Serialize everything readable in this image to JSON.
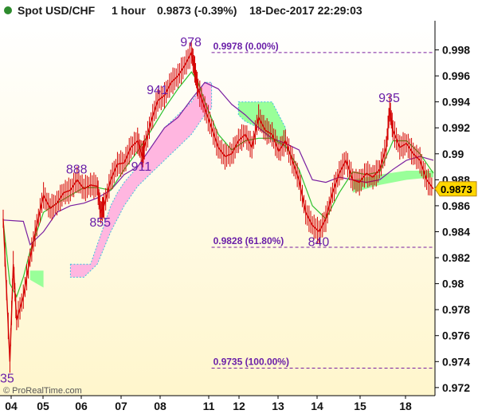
{
  "header": {
    "instrument": "Spot USD/CHF",
    "timeframe": "1 hour",
    "last_price_change": "0.9873 (-0.39%)",
    "datetime": "18-Dec-2017 22:29:03",
    "status_color": "#2e8b2e"
  },
  "credit": "© ProRealTime.com",
  "chart_data": {
    "type": "line",
    "title": "Spot USD/CHF",
    "xlabel": "",
    "ylabel": "",
    "x_ticks": [
      "04",
      "05",
      "06",
      "07",
      "08",
      "11",
      "12",
      "13",
      "14",
      "15",
      "18"
    ],
    "y_ticks": [
      "0.972",
      "0.974",
      "0.976",
      "0.978",
      "0.98",
      "0.982",
      "0.984",
      "0.986",
      "0.988",
      "0.99",
      "0.992",
      "0.994",
      "0.996",
      "0.998"
    ],
    "ylim": [
      0.9715,
      1.0
    ],
    "grid": false,
    "last_price": "0.9873",
    "last_price_value": 0.9873,
    "colors": {
      "price": "#d40000",
      "tenkan": "#2fc12f",
      "kijun": "#7a1fa0",
      "cloud_bull": "#99ff99",
      "cloud_bear": "#ffb6e0",
      "span_a_line": "#40c0e0",
      "fib_line": "#7a1fa0",
      "background_top": "#ffffff",
      "background_bottom": "#fff6cc"
    },
    "price_path": [
      [
        0.0,
        0.985
      ],
      [
        1.0,
        0.974
      ],
      [
        1.5,
        0.9815
      ],
      [
        2.0,
        0.9772
      ],
      [
        3.0,
        0.979
      ],
      [
        4.0,
        0.982
      ],
      [
        5.0,
        0.9845
      ],
      [
        6.0,
        0.9868
      ],
      [
        7.0,
        0.9858
      ],
      [
        8.0,
        0.9862
      ],
      [
        9.0,
        0.987
      ],
      [
        10.0,
        0.9872
      ],
      [
        11.0,
        0.988
      ],
      [
        12.0,
        0.9873
      ],
      [
        13.0,
        0.9876
      ],
      [
        14.0,
        0.9875
      ],
      [
        14.5,
        0.9855
      ],
      [
        15.0,
        0.986
      ],
      [
        16.0,
        0.988
      ],
      [
        17.0,
        0.9892
      ],
      [
        18.0,
        0.9893
      ],
      [
        19.0,
        0.9905
      ],
      [
        20.0,
        0.991
      ],
      [
        20.7,
        0.9898
      ],
      [
        21.0,
        0.9905
      ],
      [
        22.0,
        0.9925
      ],
      [
        23.0,
        0.9941
      ],
      [
        24.0,
        0.9945
      ],
      [
        25.0,
        0.9955
      ],
      [
        26.0,
        0.996
      ],
      [
        27.0,
        0.9968
      ],
      [
        28.0,
        0.9978
      ],
      [
        28.5,
        0.9965
      ],
      [
        29.0,
        0.995
      ],
      [
        30.0,
        0.9935
      ],
      [
        31.0,
        0.992
      ],
      [
        32.0,
        0.9905
      ],
      [
        33.0,
        0.9898
      ],
      [
        34.0,
        0.99
      ],
      [
        35.0,
        0.991
      ],
      [
        36.0,
        0.9915
      ],
      [
        37.0,
        0.9905
      ],
      [
        38.0,
        0.9928
      ],
      [
        39.0,
        0.9918
      ],
      [
        40.0,
        0.9915
      ],
      [
        41.0,
        0.9902
      ],
      [
        42.0,
        0.991
      ],
      [
        43.0,
        0.9895
      ],
      [
        44.0,
        0.988
      ],
      [
        45.0,
        0.9855
      ],
      [
        46.0,
        0.9845
      ],
      [
        47.0,
        0.984
      ],
      [
        48.0,
        0.985
      ],
      [
        49.0,
        0.987
      ],
      [
        50.0,
        0.9885
      ],
      [
        51.0,
        0.9895
      ],
      [
        52.0,
        0.988
      ],
      [
        53.0,
        0.9878
      ],
      [
        54.0,
        0.9885
      ],
      [
        55.0,
        0.9882
      ],
      [
        56.0,
        0.9888
      ],
      [
        57.0,
        0.9905
      ],
      [
        57.5,
        0.9935
      ],
      [
        58.0,
        0.9918
      ],
      [
        59.0,
        0.9905
      ],
      [
        60.0,
        0.9908
      ],
      [
        61.0,
        0.99
      ],
      [
        62.0,
        0.9895
      ],
      [
        63.0,
        0.988
      ],
      [
        64.0,
        0.9873
      ]
    ],
    "tenkan_path": [
      [
        0.0,
        0.9848
      ],
      [
        1.0,
        0.98
      ],
      [
        2.0,
        0.979
      ],
      [
        3.0,
        0.9805
      ],
      [
        4.0,
        0.9825
      ],
      [
        6.0,
        0.9855
      ],
      [
        8.0,
        0.9862
      ],
      [
        10.0,
        0.9868
      ],
      [
        12.0,
        0.9874
      ],
      [
        14.0,
        0.9874
      ],
      [
        16.0,
        0.9872
      ],
      [
        18.0,
        0.9888
      ],
      [
        20.0,
        0.9902
      ],
      [
        22.0,
        0.9918
      ],
      [
        24.0,
        0.9935
      ],
      [
        26.0,
        0.995
      ],
      [
        28.0,
        0.9963
      ],
      [
        29.0,
        0.9955
      ],
      [
        30.0,
        0.994
      ],
      [
        32.0,
        0.9915
      ],
      [
        34.0,
        0.9903
      ],
      [
        36.0,
        0.991
      ],
      [
        38.0,
        0.9912
      ],
      [
        40.0,
        0.9912
      ],
      [
        42.0,
        0.9906
      ],
      [
        44.0,
        0.9888
      ],
      [
        46.0,
        0.986
      ],
      [
        48.0,
        0.985
      ],
      [
        50.0,
        0.987
      ],
      [
        52.0,
        0.9886
      ],
      [
        54.0,
        0.9884
      ],
      [
        56.0,
        0.9886
      ],
      [
        58.0,
        0.991
      ],
      [
        60.0,
        0.991
      ],
      [
        62.0,
        0.99
      ],
      [
        64.0,
        0.9885
      ]
    ],
    "kijun_path": [
      [
        0.0,
        0.9849
      ],
      [
        3.0,
        0.9848
      ],
      [
        4.0,
        0.983
      ],
      [
        6.0,
        0.984
      ],
      [
        8.0,
        0.9855
      ],
      [
        10.0,
        0.986
      ],
      [
        12.0,
        0.9862
      ],
      [
        14.0,
        0.9866
      ],
      [
        16.0,
        0.9872
      ],
      [
        18.0,
        0.9884
      ],
      [
        20.0,
        0.989
      ],
      [
        22.0,
        0.9905
      ],
      [
        24.0,
        0.992
      ],
      [
        26.0,
        0.9928
      ],
      [
        28.0,
        0.9942
      ],
      [
        30.0,
        0.9955
      ],
      [
        32.0,
        0.995
      ],
      [
        34.0,
        0.9938
      ],
      [
        36.0,
        0.993
      ],
      [
        38.0,
        0.992
      ],
      [
        40.0,
        0.9912
      ],
      [
        42.0,
        0.9908
      ],
      [
        44.0,
        0.9903
      ],
      [
        46.0,
        0.988
      ],
      [
        48.0,
        0.9878
      ],
      [
        50.0,
        0.9882
      ],
      [
        52.0,
        0.988
      ],
      [
        54.0,
        0.9878
      ],
      [
        56.0,
        0.988
      ],
      [
        58.0,
        0.9888
      ],
      [
        60.0,
        0.9895
      ],
      [
        62.0,
        0.9898
      ],
      [
        64.0,
        0.9895
      ]
    ],
    "cloud_bear_polygon": [
      [
        10.0,
        0.9815
      ],
      [
        11.0,
        0.9815
      ],
      [
        13.0,
        0.9815
      ],
      [
        14.0,
        0.983
      ],
      [
        15.0,
        0.9845
      ],
      [
        16.0,
        0.986
      ],
      [
        17.0,
        0.987
      ],
      [
        18.0,
        0.9878
      ],
      [
        20.0,
        0.989
      ],
      [
        22.0,
        0.9905
      ],
      [
        24.0,
        0.992
      ],
      [
        26.0,
        0.993
      ],
      [
        28.0,
        0.994
      ],
      [
        30.0,
        0.9955
      ],
      [
        31.0,
        0.9955
      ],
      [
        31.0,
        0.9935
      ],
      [
        30.0,
        0.993
      ],
      [
        28.0,
        0.9915
      ],
      [
        26.0,
        0.9905
      ],
      [
        24.0,
        0.9895
      ],
      [
        22.0,
        0.9885
      ],
      [
        20.0,
        0.9875
      ],
      [
        18.0,
        0.986
      ],
      [
        16.0,
        0.984
      ],
      [
        14.0,
        0.9815
      ],
      [
        12.0,
        0.9805
      ],
      [
        10.0,
        0.9805
      ]
    ],
    "cloud_bull_polygon": [
      [
        4.0,
        0.981
      ],
      [
        6.0,
        0.981
      ],
      [
        6.0,
        0.9797
      ],
      [
        4.0,
        0.9803
      ]
    ],
    "cloud_bull_polygon_2": [
      [
        35.0,
        0.994
      ],
      [
        40.0,
        0.994
      ],
      [
        41.0,
        0.993
      ],
      [
        42.0,
        0.992
      ],
      [
        42.0,
        0.9905
      ],
      [
        40.0,
        0.991
      ],
      [
        38.0,
        0.992
      ],
      [
        36.0,
        0.9925
      ],
      [
        35.0,
        0.993
      ]
    ],
    "cloud_bull_polygon_3": [
      [
        52.0,
        0.988
      ],
      [
        56.0,
        0.9884
      ],
      [
        60.0,
        0.9887
      ],
      [
        64.0,
        0.9887
      ],
      [
        64.0,
        0.9882
      ],
      [
        60.0,
        0.988
      ],
      [
        56.0,
        0.9876
      ],
      [
        52.0,
        0.987
      ]
    ],
    "fib_levels": [
      {
        "label": "0.9978 (0.00%)",
        "value": 0.9978
      },
      {
        "label": "0.9828 (61.80%)",
        "value": 0.9828
      },
      {
        "label": "0.9735 (100.00%)",
        "value": 0.9735
      }
    ],
    "annotations": [
      {
        "text": "978",
        "x": 28.0,
        "y": 0.9978
      },
      {
        "text": "941",
        "x": 23.0,
        "y": 0.9941
      },
      {
        "text": "911",
        "x": 20.7,
        "y": 0.9898
      },
      {
        "text": "888",
        "x": 11.0,
        "y": 0.988
      },
      {
        "text": "855",
        "x": 14.5,
        "y": 0.9855
      },
      {
        "text": "840",
        "x": 47.0,
        "y": 0.984
      },
      {
        "text": "935",
        "x": 57.5,
        "y": 0.9935
      },
      {
        "text": "35",
        "x": 0.0,
        "y": 0.9735
      }
    ]
  }
}
